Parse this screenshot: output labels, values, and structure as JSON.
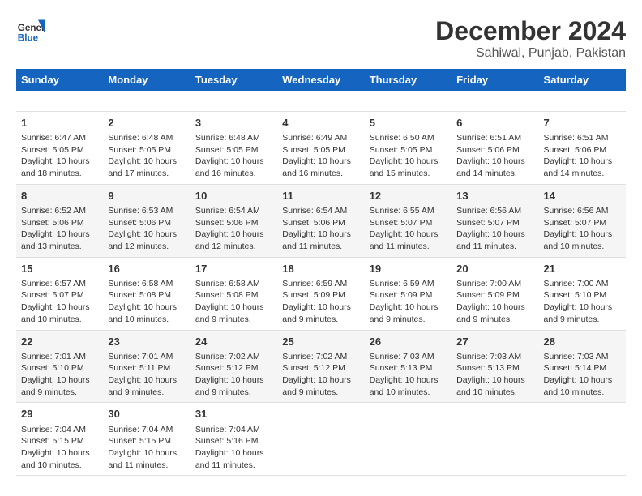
{
  "header": {
    "logo_line1": "General",
    "logo_line2": "Blue",
    "title": "December 2024",
    "subtitle": "Sahiwal, Punjab, Pakistan"
  },
  "calendar": {
    "columns": [
      "Sunday",
      "Monday",
      "Tuesday",
      "Wednesday",
      "Thursday",
      "Friday",
      "Saturday"
    ],
    "weeks": [
      [
        {
          "day": "",
          "info": ""
        },
        {
          "day": "",
          "info": ""
        },
        {
          "day": "",
          "info": ""
        },
        {
          "day": "",
          "info": ""
        },
        {
          "day": "",
          "info": ""
        },
        {
          "day": "",
          "info": ""
        },
        {
          "day": "",
          "info": ""
        }
      ],
      [
        {
          "day": "1",
          "info": "Sunrise: 6:47 AM\nSunset: 5:05 PM\nDaylight: 10 hours and 18 minutes."
        },
        {
          "day": "2",
          "info": "Sunrise: 6:48 AM\nSunset: 5:05 PM\nDaylight: 10 hours and 17 minutes."
        },
        {
          "day": "3",
          "info": "Sunrise: 6:48 AM\nSunset: 5:05 PM\nDaylight: 10 hours and 16 minutes."
        },
        {
          "day": "4",
          "info": "Sunrise: 6:49 AM\nSunset: 5:05 PM\nDaylight: 10 hours and 16 minutes."
        },
        {
          "day": "5",
          "info": "Sunrise: 6:50 AM\nSunset: 5:05 PM\nDaylight: 10 hours and 15 minutes."
        },
        {
          "day": "6",
          "info": "Sunrise: 6:51 AM\nSunset: 5:06 PM\nDaylight: 10 hours and 14 minutes."
        },
        {
          "day": "7",
          "info": "Sunrise: 6:51 AM\nSunset: 5:06 PM\nDaylight: 10 hours and 14 minutes."
        }
      ],
      [
        {
          "day": "8",
          "info": "Sunrise: 6:52 AM\nSunset: 5:06 PM\nDaylight: 10 hours and 13 minutes."
        },
        {
          "day": "9",
          "info": "Sunrise: 6:53 AM\nSunset: 5:06 PM\nDaylight: 10 hours and 12 minutes."
        },
        {
          "day": "10",
          "info": "Sunrise: 6:54 AM\nSunset: 5:06 PM\nDaylight: 10 hours and 12 minutes."
        },
        {
          "day": "11",
          "info": "Sunrise: 6:54 AM\nSunset: 5:06 PM\nDaylight: 10 hours and 11 minutes."
        },
        {
          "day": "12",
          "info": "Sunrise: 6:55 AM\nSunset: 5:07 PM\nDaylight: 10 hours and 11 minutes."
        },
        {
          "day": "13",
          "info": "Sunrise: 6:56 AM\nSunset: 5:07 PM\nDaylight: 10 hours and 11 minutes."
        },
        {
          "day": "14",
          "info": "Sunrise: 6:56 AM\nSunset: 5:07 PM\nDaylight: 10 hours and 10 minutes."
        }
      ],
      [
        {
          "day": "15",
          "info": "Sunrise: 6:57 AM\nSunset: 5:07 PM\nDaylight: 10 hours and 10 minutes."
        },
        {
          "day": "16",
          "info": "Sunrise: 6:58 AM\nSunset: 5:08 PM\nDaylight: 10 hours and 10 minutes."
        },
        {
          "day": "17",
          "info": "Sunrise: 6:58 AM\nSunset: 5:08 PM\nDaylight: 10 hours and 9 minutes."
        },
        {
          "day": "18",
          "info": "Sunrise: 6:59 AM\nSunset: 5:09 PM\nDaylight: 10 hours and 9 minutes."
        },
        {
          "day": "19",
          "info": "Sunrise: 6:59 AM\nSunset: 5:09 PM\nDaylight: 10 hours and 9 minutes."
        },
        {
          "day": "20",
          "info": "Sunrise: 7:00 AM\nSunset: 5:09 PM\nDaylight: 10 hours and 9 minutes."
        },
        {
          "day": "21",
          "info": "Sunrise: 7:00 AM\nSunset: 5:10 PM\nDaylight: 10 hours and 9 minutes."
        }
      ],
      [
        {
          "day": "22",
          "info": "Sunrise: 7:01 AM\nSunset: 5:10 PM\nDaylight: 10 hours and 9 minutes."
        },
        {
          "day": "23",
          "info": "Sunrise: 7:01 AM\nSunset: 5:11 PM\nDaylight: 10 hours and 9 minutes."
        },
        {
          "day": "24",
          "info": "Sunrise: 7:02 AM\nSunset: 5:12 PM\nDaylight: 10 hours and 9 minutes."
        },
        {
          "day": "25",
          "info": "Sunrise: 7:02 AM\nSunset: 5:12 PM\nDaylight: 10 hours and 9 minutes."
        },
        {
          "day": "26",
          "info": "Sunrise: 7:03 AM\nSunset: 5:13 PM\nDaylight: 10 hours and 10 minutes."
        },
        {
          "day": "27",
          "info": "Sunrise: 7:03 AM\nSunset: 5:13 PM\nDaylight: 10 hours and 10 minutes."
        },
        {
          "day": "28",
          "info": "Sunrise: 7:03 AM\nSunset: 5:14 PM\nDaylight: 10 hours and 10 minutes."
        }
      ],
      [
        {
          "day": "29",
          "info": "Sunrise: 7:04 AM\nSunset: 5:15 PM\nDaylight: 10 hours and 10 minutes."
        },
        {
          "day": "30",
          "info": "Sunrise: 7:04 AM\nSunset: 5:15 PM\nDaylight: 10 hours and 11 minutes."
        },
        {
          "day": "31",
          "info": "Sunrise: 7:04 AM\nSunset: 5:16 PM\nDaylight: 10 hours and 11 minutes."
        },
        {
          "day": "",
          "info": ""
        },
        {
          "day": "",
          "info": ""
        },
        {
          "day": "",
          "info": ""
        },
        {
          "day": "",
          "info": ""
        }
      ]
    ]
  }
}
